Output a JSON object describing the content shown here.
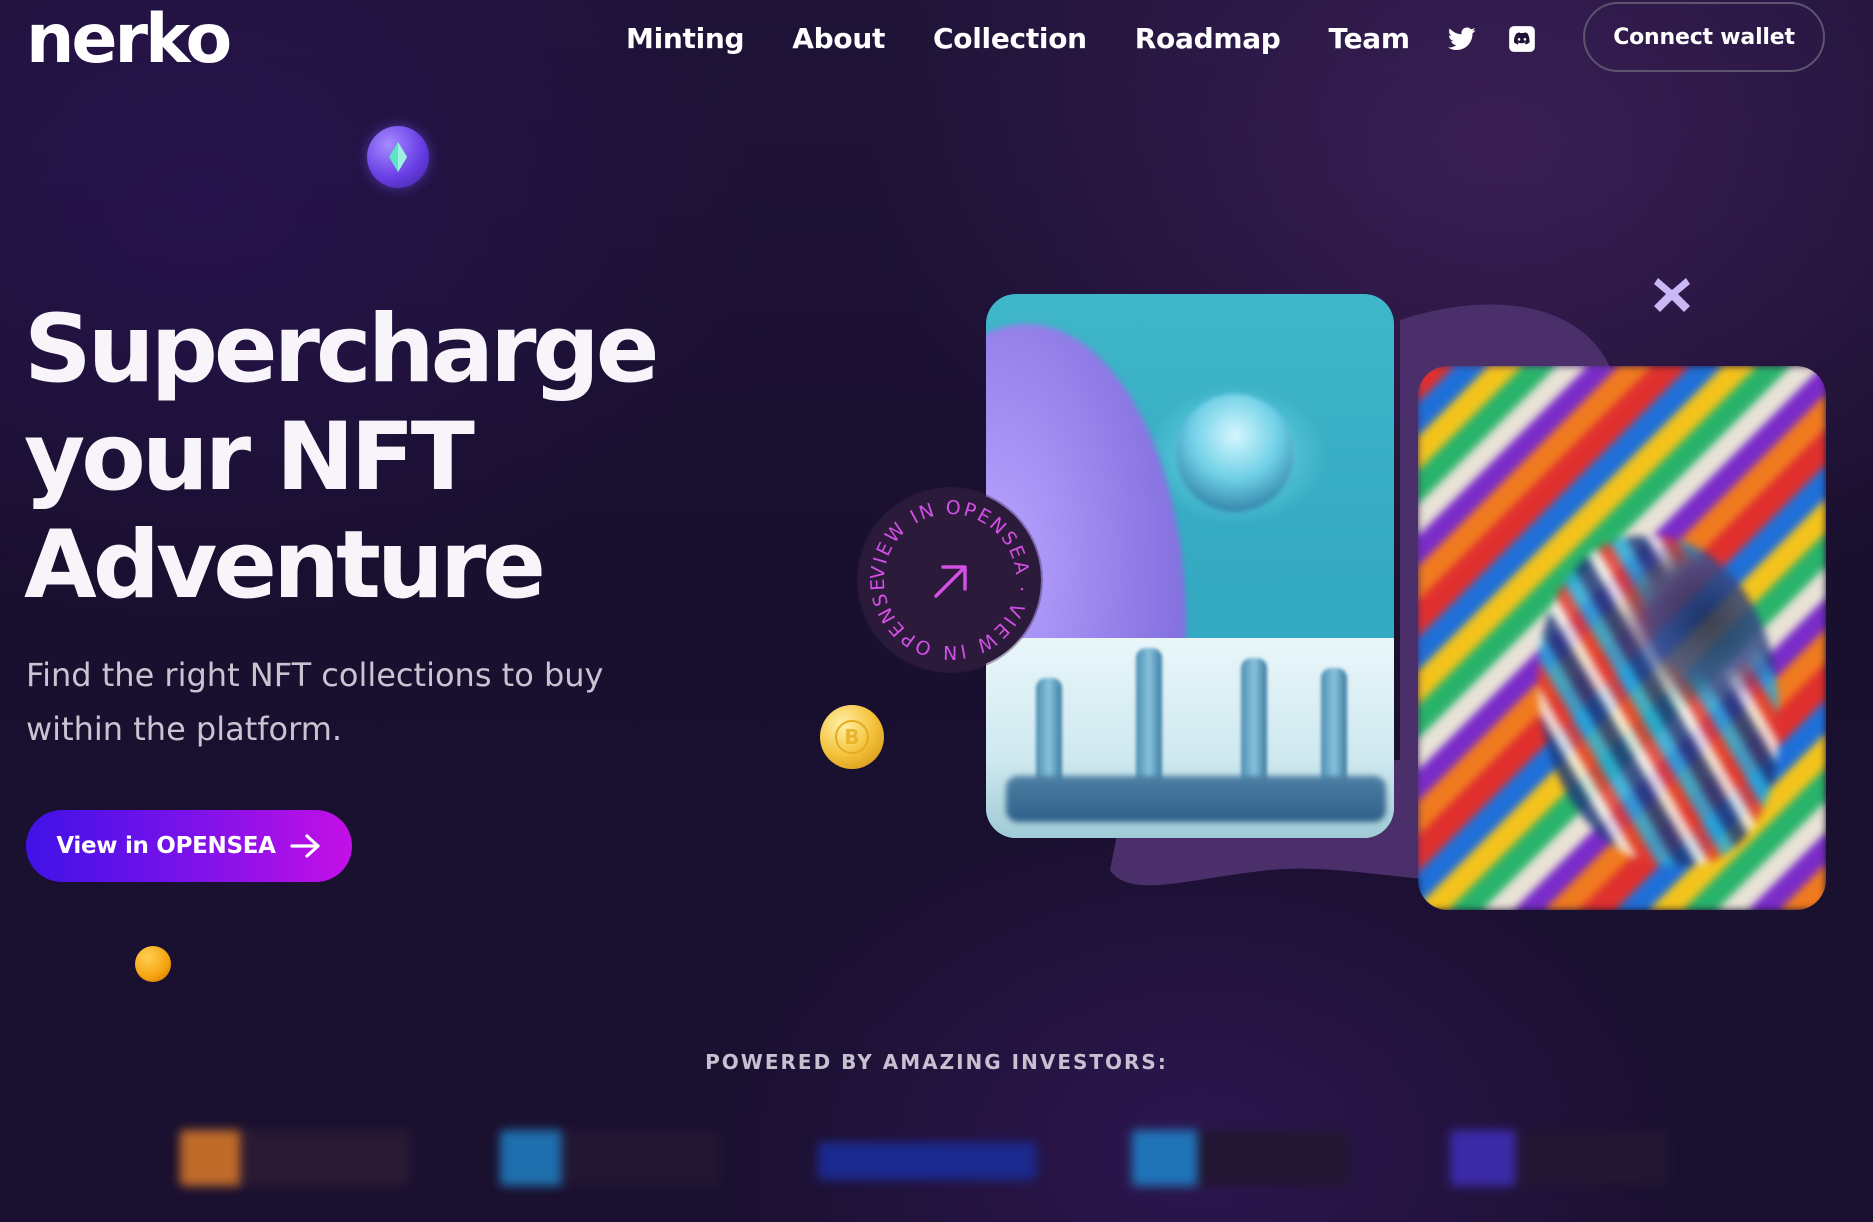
{
  "header": {
    "logo_text": "nerko",
    "nav": [
      {
        "label": "Minting"
      },
      {
        "label": "About"
      },
      {
        "label": "Collection"
      },
      {
        "label": "Roadmap"
      },
      {
        "label": "Team"
      }
    ],
    "social": [
      {
        "icon": "twitter-icon"
      },
      {
        "icon": "discord-icon"
      }
    ],
    "connect_wallet_label": "Connect wallet"
  },
  "hero": {
    "title_lines": [
      "Supercharge",
      "your NFT",
      "Adventure"
    ],
    "subtitle": "Find the right NFT collections to buy within the platform.",
    "cta_label": "View in OPENSEA",
    "cta_icon": "arrow-right-icon"
  },
  "opensea_badge": {
    "ring_text": "VIEW IN OPENSEA · VIEW IN OPENSEA · ",
    "icon": "arrow-up-right-icon"
  },
  "investors": {
    "label": "POWERED BY AMAZING INVESTORS:",
    "logos": [
      "investor-logo-1",
      "investor-logo-2",
      "investor-logo-3",
      "investor-logo-4",
      "investor-logo-5"
    ]
  },
  "colors": {
    "background": "#1c1132",
    "cta_gradient_start": "#3f12e8",
    "cta_gradient_end": "#c410e6",
    "badge_text": "#d34fe6",
    "blob": "#4b2f6b"
  }
}
